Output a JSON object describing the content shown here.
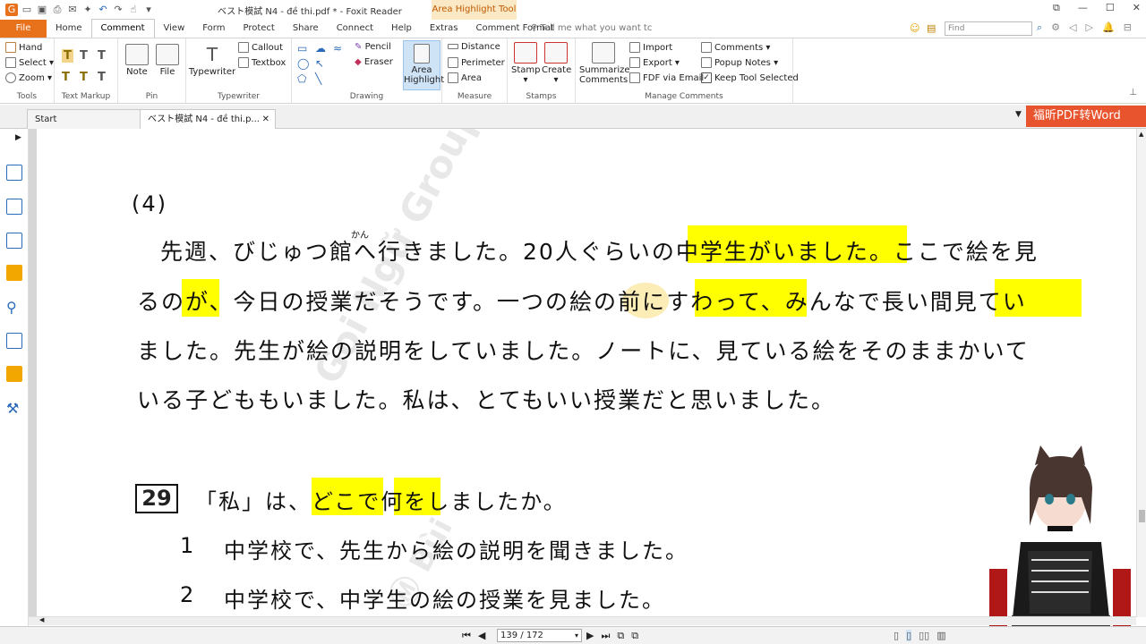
{
  "window": {
    "title": "ベスト模試 N4 -  đề thi.pdf * - Foxit Reader",
    "context_tab": "Area Highlight Tool",
    "qa_icons": [
      "app-icon",
      "open-icon",
      "save-icon",
      "print-icon",
      "mail-icon",
      "new-icon",
      "undo-icon",
      "redo-icon",
      "hand-icon",
      "dropdown-icon"
    ]
  },
  "menu": {
    "tabs": [
      "File",
      "Home",
      "Comment",
      "View",
      "Form",
      "Protect",
      "Share",
      "Connect",
      "Help",
      "Extras",
      "Comment Format"
    ],
    "active": "Comment",
    "tell_me": "Tell me what you want tc",
    "find_placeholder": "Find"
  },
  "ribbon": {
    "tools": {
      "label": "Tools",
      "hand": "Hand",
      "select": "Select",
      "zoom": "Zoom"
    },
    "text_markup": {
      "label": "Text Markup"
    },
    "pin": {
      "label": "Pin",
      "note": "Note",
      "file": "File"
    },
    "typewriter": {
      "label": "Typewriter",
      "typewriter": "Typewriter",
      "callout": "Callout",
      "textbox": "Textbox"
    },
    "drawing": {
      "label": "Drawing",
      "pencil": "Pencil",
      "eraser": "Eraser",
      "area_highlight_1": "Area",
      "area_highlight_2": "Highlight"
    },
    "measure": {
      "label": "Measure",
      "distance": "Distance",
      "perimeter": "Perimeter",
      "area": "Area"
    },
    "stamps": {
      "label": "Stamps",
      "stamp": "Stamp",
      "create": "Create"
    },
    "manage": {
      "label": "Manage Comments",
      "summarize_1": "Summarize",
      "summarize_2": "Comments",
      "import": "Import",
      "export": "Export",
      "fdf": "FDF via Email",
      "comments": "Comments",
      "popup": "Popup Notes",
      "keep": "Keep Tool Selected"
    }
  },
  "doc_tabs": {
    "start": "Start",
    "current": "ベスト模試 N4 -  đề thi.p..."
  },
  "promo": "福昕PDF转Word",
  "document": {
    "section": "(4)",
    "furigana": "かん",
    "lines": [
      "先週、びじゅつ館へ行きました。20人ぐらいの中学生がいました。ここで絵を見",
      "るのが、今日の授業だそうです。一つの絵の前にすわって、みんなで長い間見てい",
      "ました。先生が絵の説明をしていました。ノートに、見ている絵をそのままかいて",
      "いる子どももいました。私は、とてもいい授業だと思いました。"
    ],
    "question_number": "29",
    "question": "「私」は、どこで何をしましたか。",
    "options": [
      {
        "num": "1",
        "text": "中学校で、先生から絵の説明を聞きました。"
      },
      {
        "num": "2",
        "text": "中学校で、中学生の絵の授業を見ました。"
      }
    ],
    "watermark_1": "Goi Ngữ Group",
    "watermark_2": "Ⓜ Bùi"
  },
  "status": {
    "page": "139 / 172"
  },
  "colors": {
    "accent": "#e8711b",
    "highlight": "#ffff00",
    "promo": "#e8542d"
  }
}
